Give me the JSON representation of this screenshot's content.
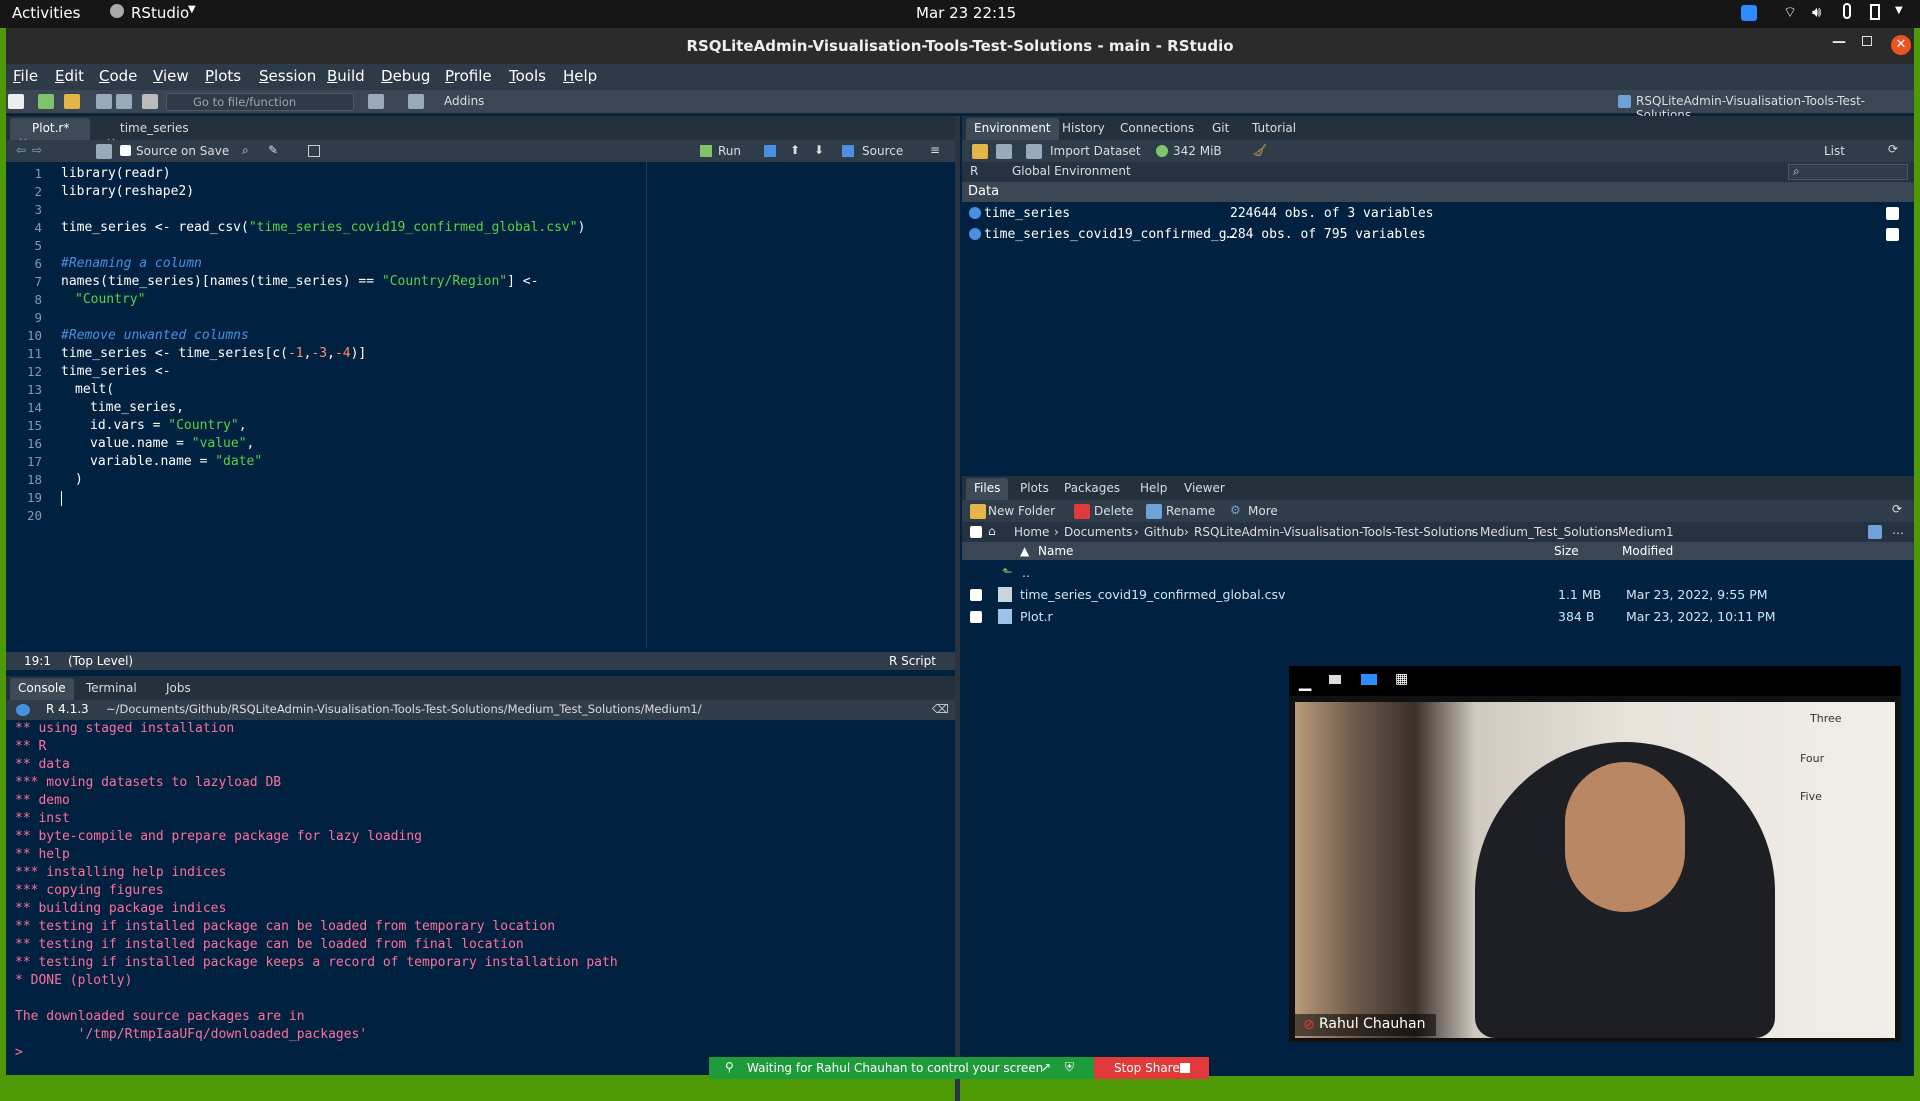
{
  "topbar": {
    "activities": "Activities",
    "app": "RStudio",
    "datetime": "Mar 23  22:15"
  },
  "window": {
    "title": "RSQLiteAdmin-Visualisation-Tools-Test-Solutions - main - RStudio"
  },
  "menu": [
    "File",
    "Edit",
    "Code",
    "View",
    "Plots",
    "Session",
    "Build",
    "Debug",
    "Profile",
    "Tools",
    "Help"
  ],
  "toolbar": {
    "goto_placeholder": "Go to file/function",
    "addins": "Addins",
    "project": "RSQLiteAdmin-Visualisation-Tools-Test-Solutions"
  },
  "editor": {
    "tabs": [
      "Plot.r*",
      "time_series"
    ],
    "source_on_save": "Source on Save",
    "run": "Run",
    "source": "Source",
    "status_pos": "19:1",
    "status_scope": "(Top Level)",
    "status_type": "R Script",
    "line_numbers": [
      "1",
      "2",
      "3",
      "4",
      "5",
      "6",
      "7",
      "8",
      "9",
      "10",
      "11",
      "12",
      "13",
      "14",
      "15",
      "16",
      "17",
      "18",
      "19",
      "20"
    ],
    "code": {
      "l1": "library(readr)",
      "l2": "library(reshape2)",
      "l4a": "time_series <- read_csv(",
      "l4b": "\"time_series_covid19_confirmed_global.csv\"",
      "l4c": ")",
      "l6": "#Renaming a column",
      "l7a": "names(time_series)[names(time_series) == ",
      "l7b": "\"Country/Region\"",
      "l7c": "] <-",
      "l8": "\"Country\"",
      "l10": "#Remove unwanted columns",
      "l11a": "time_series <- time_series[c(",
      "l11b": "-1",
      "l11c": ",",
      "l11d": "-3",
      "l11e": ",",
      "l11f": "-4",
      "l11g": ")]",
      "l12": "time_series <-",
      "l13": "melt(",
      "l14": "time_series,",
      "l15a": "id.vars = ",
      "l15b": "\"Country\"",
      "l15c": ",",
      "l16a": "value.name = ",
      "l16b": "\"value\"",
      "l16c": ",",
      "l17a": "variable.name = ",
      "l17b": "\"date\"",
      "l18": ")"
    }
  },
  "console": {
    "tabs": [
      "Console",
      "Terminal",
      "Jobs"
    ],
    "rversion": "R 4.1.3",
    "path": "~/Documents/Github/RSQLiteAdmin-Visualisation-Tools-Test-Solutions/Medium_Test_Solutions/Medium1/",
    "lines": [
      "** using staged installation",
      "** R",
      "** data",
      "*** moving datasets to lazyload DB",
      "** demo",
      "** inst",
      "** byte-compile and prepare package for lazy loading",
      "** help",
      "*** installing help indices",
      "*** copying figures",
      "** building package indices",
      "** testing if installed package can be loaded from temporary location",
      "** testing if installed package can be loaded from final location",
      "** testing if installed package keeps a record of temporary installation path",
      "* DONE (plotly)",
      "",
      "The downloaded source packages are in",
      "        '/tmp/RtmpIaaUFq/downloaded_packages'"
    ],
    "prompt": ">"
  },
  "environment": {
    "tabs": [
      "Environment",
      "History",
      "Connections",
      "Git",
      "Tutorial"
    ],
    "import_dataset": "Import Dataset",
    "memory": "342 MiB",
    "list": "List",
    "lang": "R",
    "scope": "Global Environment",
    "section": "Data",
    "rows": [
      {
        "name": "time_series",
        "desc": "224644 obs. of 3 variables"
      },
      {
        "name": "time_series_covid19_confirmed_g…",
        "desc": "284 obs. of 795 variables"
      }
    ]
  },
  "files": {
    "tabs": [
      "Files",
      "Plots",
      "Packages",
      "Help",
      "Viewer"
    ],
    "new_folder": "New Folder",
    "delete": "Delete",
    "rename": "Rename",
    "more": "More",
    "breadcrumb": [
      "Home",
      "Documents",
      "Github",
      "RSQLiteAdmin-Visualisation-Tools-Test-Solutions",
      "Medium_Test_Solutions",
      "Medium1"
    ],
    "columns": {
      "name": "Name",
      "size": "Size",
      "modified": "Modified"
    },
    "up": "..",
    "rows": [
      {
        "name": "time_series_covid19_confirmed_global.csv",
        "size": "1.1 MB",
        "modified": "Mar 23, 2022, 9:55 PM"
      },
      {
        "name": "Plot.r",
        "size": "384 B",
        "modified": "Mar 23, 2022, 10:11 PM"
      }
    ]
  },
  "video": {
    "participant": "Rahul Chauhan",
    "sign_words": [
      "Three",
      "Four",
      "Five"
    ]
  },
  "share": {
    "waiting": "Waiting for Rahul Chauhan to control your screen",
    "stop": "Stop Share"
  },
  "colors": {
    "bg": "#002240",
    "string": "#57d14a",
    "comment": "#4a90e2",
    "console_text": "#ff6f9b",
    "share_green": "#1e9c3c",
    "stop_red": "#e03a3a"
  }
}
